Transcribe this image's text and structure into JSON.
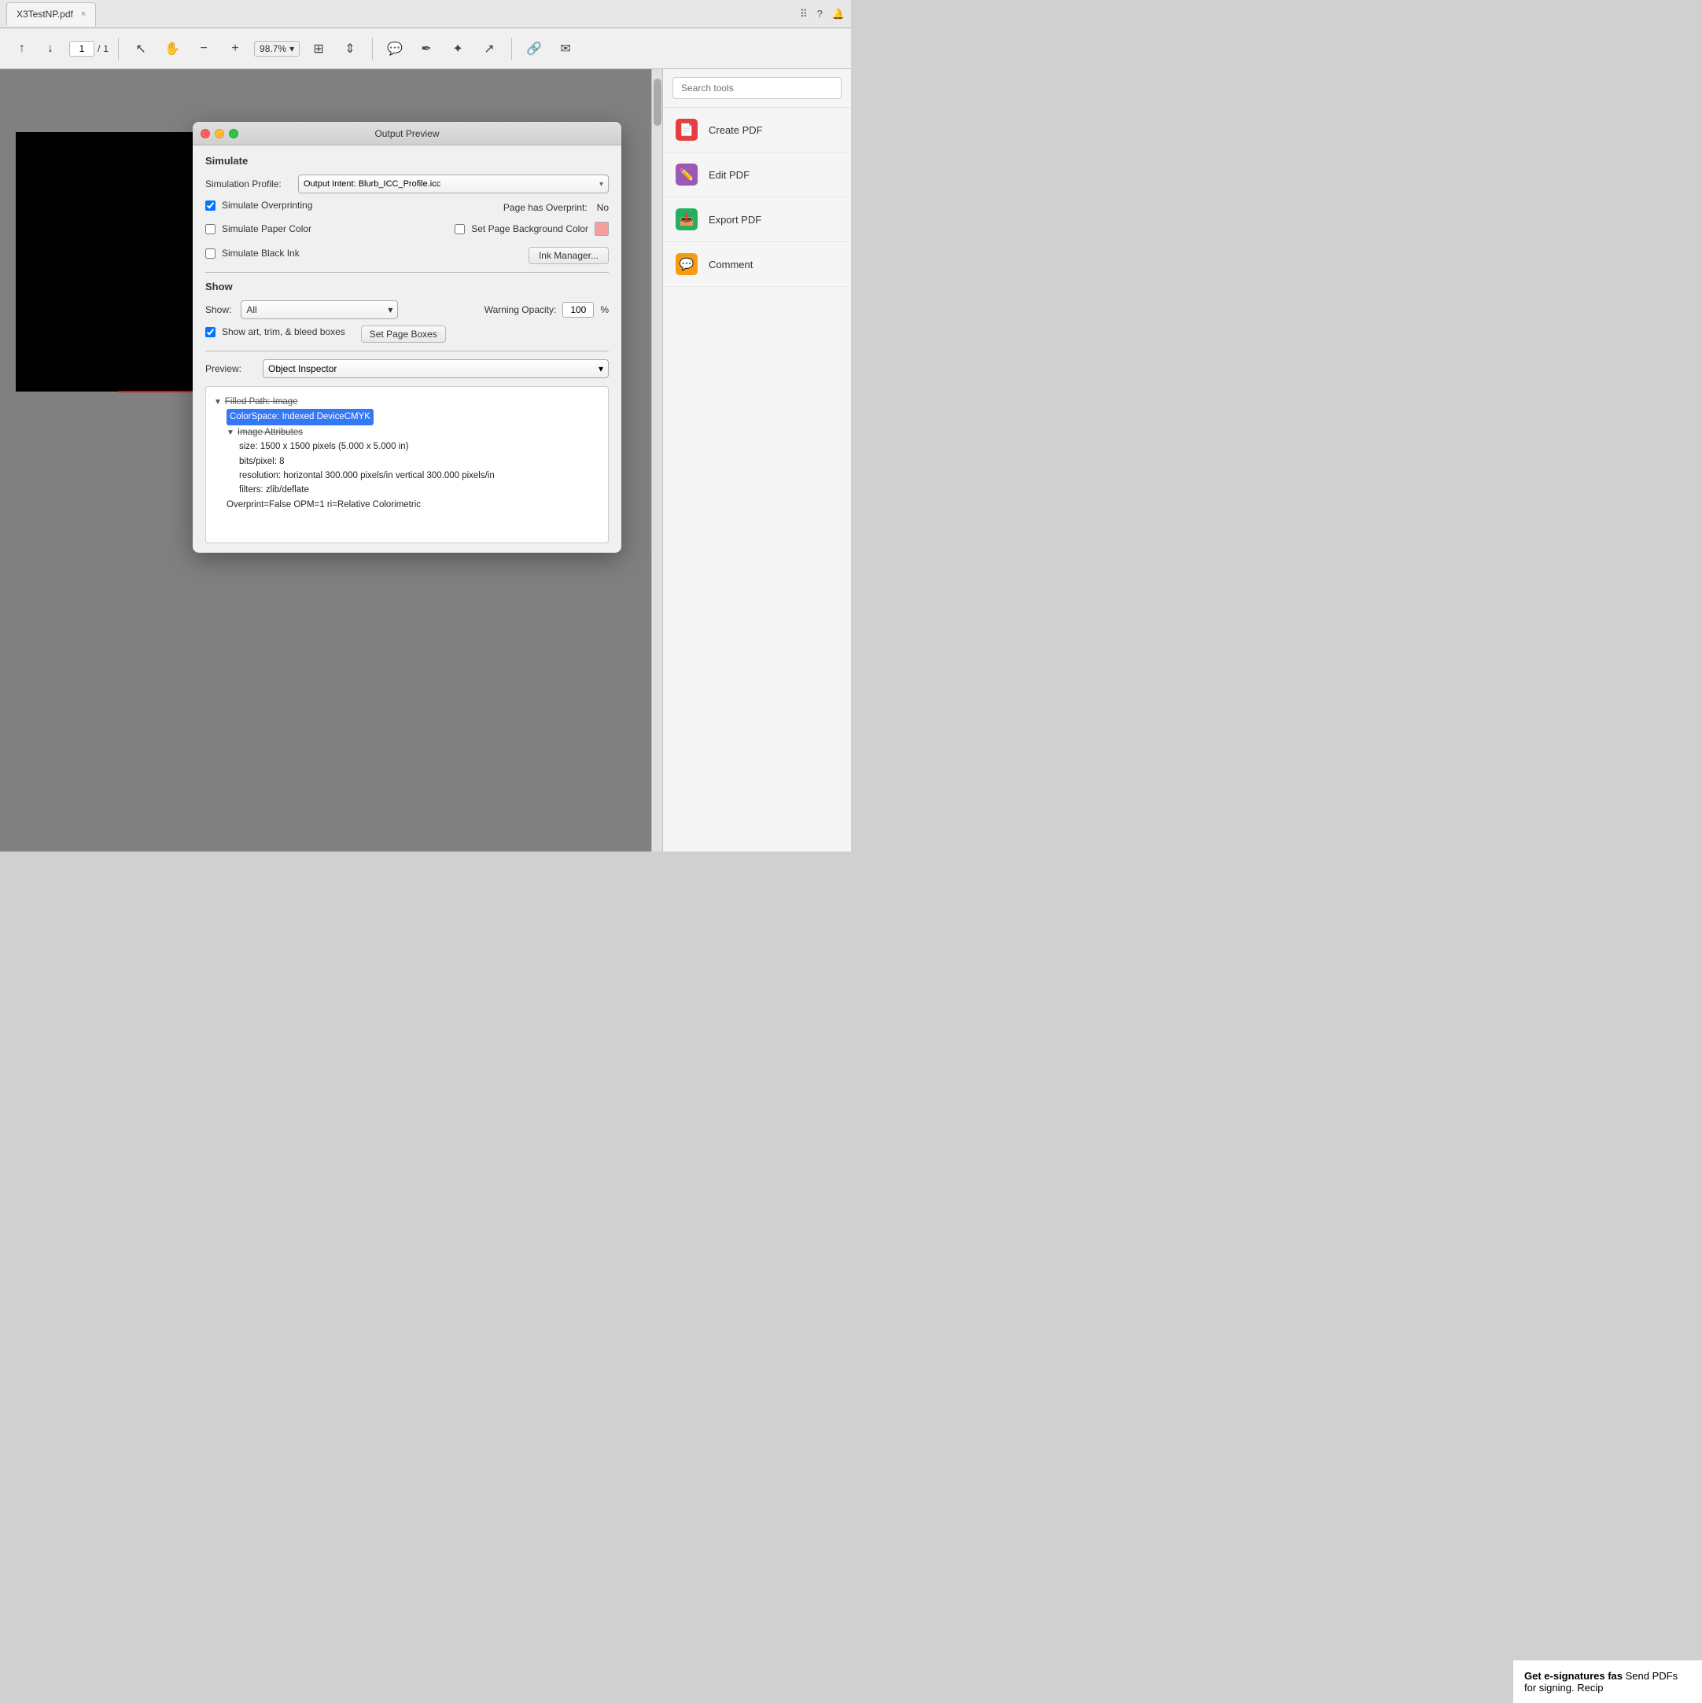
{
  "tab": {
    "filename": "X3TestNP.pdf",
    "close_label": "×"
  },
  "toolbar": {
    "page_current": "1",
    "page_total": "1",
    "zoom_value": "98.7%",
    "zoom_dropdown_arrow": "▾"
  },
  "right_panel": {
    "search_placeholder": "Search tools",
    "tools": [
      {
        "id": "create-pdf",
        "label": "Create PDF",
        "icon": "📄",
        "icon_class": "tool-icon-pdf"
      },
      {
        "id": "edit-pdf",
        "label": "Edit PDF",
        "icon": "✏️",
        "icon_class": "tool-icon-edit"
      },
      {
        "id": "export-pdf",
        "label": "Export PDF",
        "icon": "📤",
        "icon_class": "tool-icon-export"
      },
      {
        "id": "comment",
        "label": "Comment",
        "icon": "💬",
        "icon_class": "tool-icon-comment"
      }
    ]
  },
  "dialog": {
    "title": "Output Preview",
    "simulate_label": "Simulate",
    "simulation_profile_label": "Simulation Profile:",
    "simulation_profile_value": "Output Intent: Blurb_ICC_Profile.icc",
    "simulate_overprinting_label": "Simulate Overprinting",
    "page_has_overprint_label": "Page has Overprint:",
    "page_has_overprint_value": "No",
    "simulate_paper_color_label": "Simulate Paper Color",
    "set_page_background_label": "Set Page Background Color",
    "simulate_black_ink_label": "Simulate Black Ink",
    "ink_manager_label": "Ink Manager...",
    "show_section_label": "Show",
    "show_label": "Show:",
    "show_value": "All",
    "warning_opacity_label": "Warning Opacity:",
    "warning_opacity_value": "100",
    "warning_opacity_unit": "%",
    "show_art_trim_label": "Show art, trim, & bleed boxes",
    "set_page_boxes_label": "Set Page Boxes",
    "preview_label": "Preview:",
    "preview_value": "Object Inspector",
    "inspector": {
      "filled_path_label": "Filled Path: Image",
      "colorspace_label": "ColorSpace: Indexed DeviceCMYK",
      "image_attributes_label": "Image Attributes",
      "size_label": "size: 1500 x 1500 pixels (5.000 x 5.000 in)",
      "bits_label": "bits/pixel: 8",
      "resolution_label": "resolution: horizontal 300.000 pixels/in vertical 300.000 pixels/in",
      "filters_label": "filters: zlib/deflate",
      "overprint_label": "Overprint=False OPM=1 ri=Relative Colorimetric"
    }
  },
  "bottom_promo": {
    "title": "Get e-signatures fas",
    "subtitle": "Send PDFs for signing. Recip"
  },
  "icons": {
    "back": "◀",
    "forward": "▶",
    "arrow_tool": "↖",
    "hand_tool": "✋",
    "zoom_out": "−",
    "zoom_in": "+",
    "fit_page": "⊞",
    "scroll": "⇕",
    "comment_icon": "💬",
    "pen": "✒",
    "stamp": "✦",
    "share": "↗",
    "link": "🔗",
    "mail": "✉",
    "triangle_down": "▼",
    "triangle_right": "▶"
  }
}
